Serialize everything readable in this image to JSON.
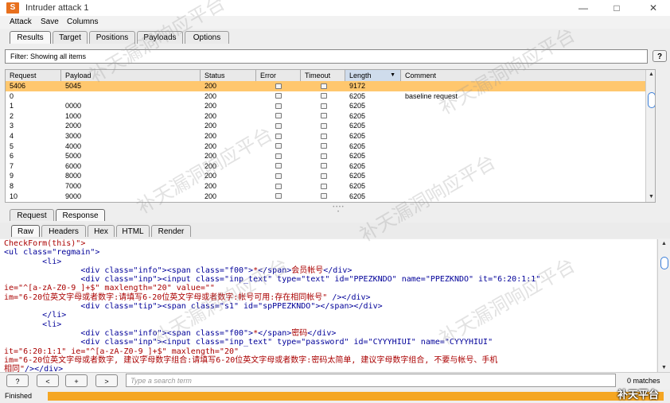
{
  "window": {
    "title": "Intruder attack 1",
    "icon": "burp-app-icon",
    "minimize": "—",
    "maximize": "□",
    "close": "✕"
  },
  "menu": [
    "Attack",
    "Save",
    "Columns"
  ],
  "tabs": [
    "Results",
    "Target",
    "Positions",
    "Payloads",
    "Options"
  ],
  "filter": {
    "text": "Filter: Showing all items",
    "help": "?"
  },
  "table": {
    "columns": [
      "Request",
      "Payload",
      "Status",
      "Error",
      "Timeout",
      "Length",
      "Comment"
    ],
    "sorted_column": "Length",
    "rows": [
      {
        "request": "5406",
        "payload": "5045",
        "status": "200",
        "length": "9172",
        "comment": "",
        "selected": true
      },
      {
        "request": "0",
        "payload": "",
        "status": "200",
        "length": "6205",
        "comment": "baseline request"
      },
      {
        "request": "1",
        "payload": "0000",
        "status": "200",
        "length": "6205",
        "comment": ""
      },
      {
        "request": "2",
        "payload": "1000",
        "status": "200",
        "length": "6205",
        "comment": ""
      },
      {
        "request": "3",
        "payload": "2000",
        "status": "200",
        "length": "6205",
        "comment": ""
      },
      {
        "request": "4",
        "payload": "3000",
        "status": "200",
        "length": "6205",
        "comment": ""
      },
      {
        "request": "5",
        "payload": "4000",
        "status": "200",
        "length": "6205",
        "comment": ""
      },
      {
        "request": "6",
        "payload": "5000",
        "status": "200",
        "length": "6205",
        "comment": ""
      },
      {
        "request": "7",
        "payload": "6000",
        "status": "200",
        "length": "6205",
        "comment": ""
      },
      {
        "request": "9",
        "payload": "8000",
        "status": "200",
        "length": "6205",
        "comment": ""
      },
      {
        "request": "8",
        "payload": "7000",
        "status": "200",
        "length": "6205",
        "comment": ""
      },
      {
        "request": "10",
        "payload": "9000",
        "status": "200",
        "length": "6205",
        "comment": ""
      }
    ]
  },
  "req_resp_tabs": [
    "Request",
    "Response"
  ],
  "view_tabs": [
    "Raw",
    "Headers",
    "Hex",
    "HTML",
    "Render"
  ],
  "code_lines": [
    [
      [
        "t",
        "CheckForm(this)\">"
      ]
    ],
    [
      [
        "g",
        "<ul class=\"regmain\">"
      ]
    ],
    [
      [
        "s",
        "        "
      ],
      [
        "g",
        "<li>"
      ]
    ],
    [
      [
        "s",
        "                "
      ],
      [
        "g",
        "<div class=\"info\">"
      ],
      [
        "g",
        "<span class=\"f00\">"
      ],
      [
        "t",
        "*"
      ],
      [
        "g",
        "</span>"
      ],
      [
        "t",
        "会员帐号"
      ],
      [
        "g",
        "</div>"
      ]
    ],
    [
      [
        "s",
        "                "
      ],
      [
        "g",
        "<div class=\"inp\">"
      ],
      [
        "g",
        "<input class=\"inp_text\" type=\"text\" id=\"PPEZKNDO\" name=\"PPEZKNDO\" it=\"6:20:1:1\""
      ]
    ],
    [
      [
        "t",
        "ie=\"^[a-zA-Z0-9_]+$\" maxlength=\"20\" value=\"\""
      ]
    ],
    [
      [
        "t",
        "im=\"6-20位英文字母或者数字:请填写6-20位英文字母或者数字:帐号可用:存在相同帐号\" "
      ],
      [
        "g",
        "/></div>"
      ]
    ],
    [
      [
        "s",
        "                "
      ],
      [
        "g",
        "<div class=\"tip\">"
      ],
      [
        "g",
        "<span class=\"s1\" id=\"spPPEZKNDO\">"
      ],
      [
        "g",
        "</span></div>"
      ]
    ],
    [
      [
        "s",
        "        "
      ],
      [
        "g",
        "</li>"
      ]
    ],
    [
      [
        "s",
        "        "
      ],
      [
        "g",
        "<li>"
      ]
    ],
    [
      [
        "s",
        "                "
      ],
      [
        "g",
        "<div class=\"info\">"
      ],
      [
        "g",
        "<span class=\"f00\">"
      ],
      [
        "t",
        "*"
      ],
      [
        "g",
        "</span>"
      ],
      [
        "t",
        "密码"
      ],
      [
        "g",
        "</div>"
      ]
    ],
    [
      [
        "s",
        "                "
      ],
      [
        "g",
        "<div class=\"inp\">"
      ],
      [
        "g",
        "<input class=\"inp_text\" type=\"password\" id=\"CYYYHIUI\" name=\"CYYYHIUI\""
      ]
    ],
    [
      [
        "t",
        "it=\"6:20:1:1\" ie=\"^[a-zA-Z0-9_]+$\" maxlength=\"20\""
      ]
    ],
    [
      [
        "t",
        "im=\"6-20位英文字母或者数字, 建议字母数字组合:请填写6-20位英文字母或者数字:密码太简单, 建议字母数字组合, 不要与帐号、手机"
      ]
    ],
    [
      [
        "t",
        "相同\""
      ],
      [
        "g",
        "/></div>"
      ]
    ]
  ],
  "search": {
    "buttons": [
      "?",
      "<",
      "+",
      ">"
    ],
    "placeholder": "Type a search term",
    "matches": "0 matches"
  },
  "status": {
    "text": "Finished",
    "progress": 1.0,
    "color": "#f5a623"
  },
  "watermark": {
    "text": "补天漏洞响应平台",
    "corner": "补天平台"
  }
}
